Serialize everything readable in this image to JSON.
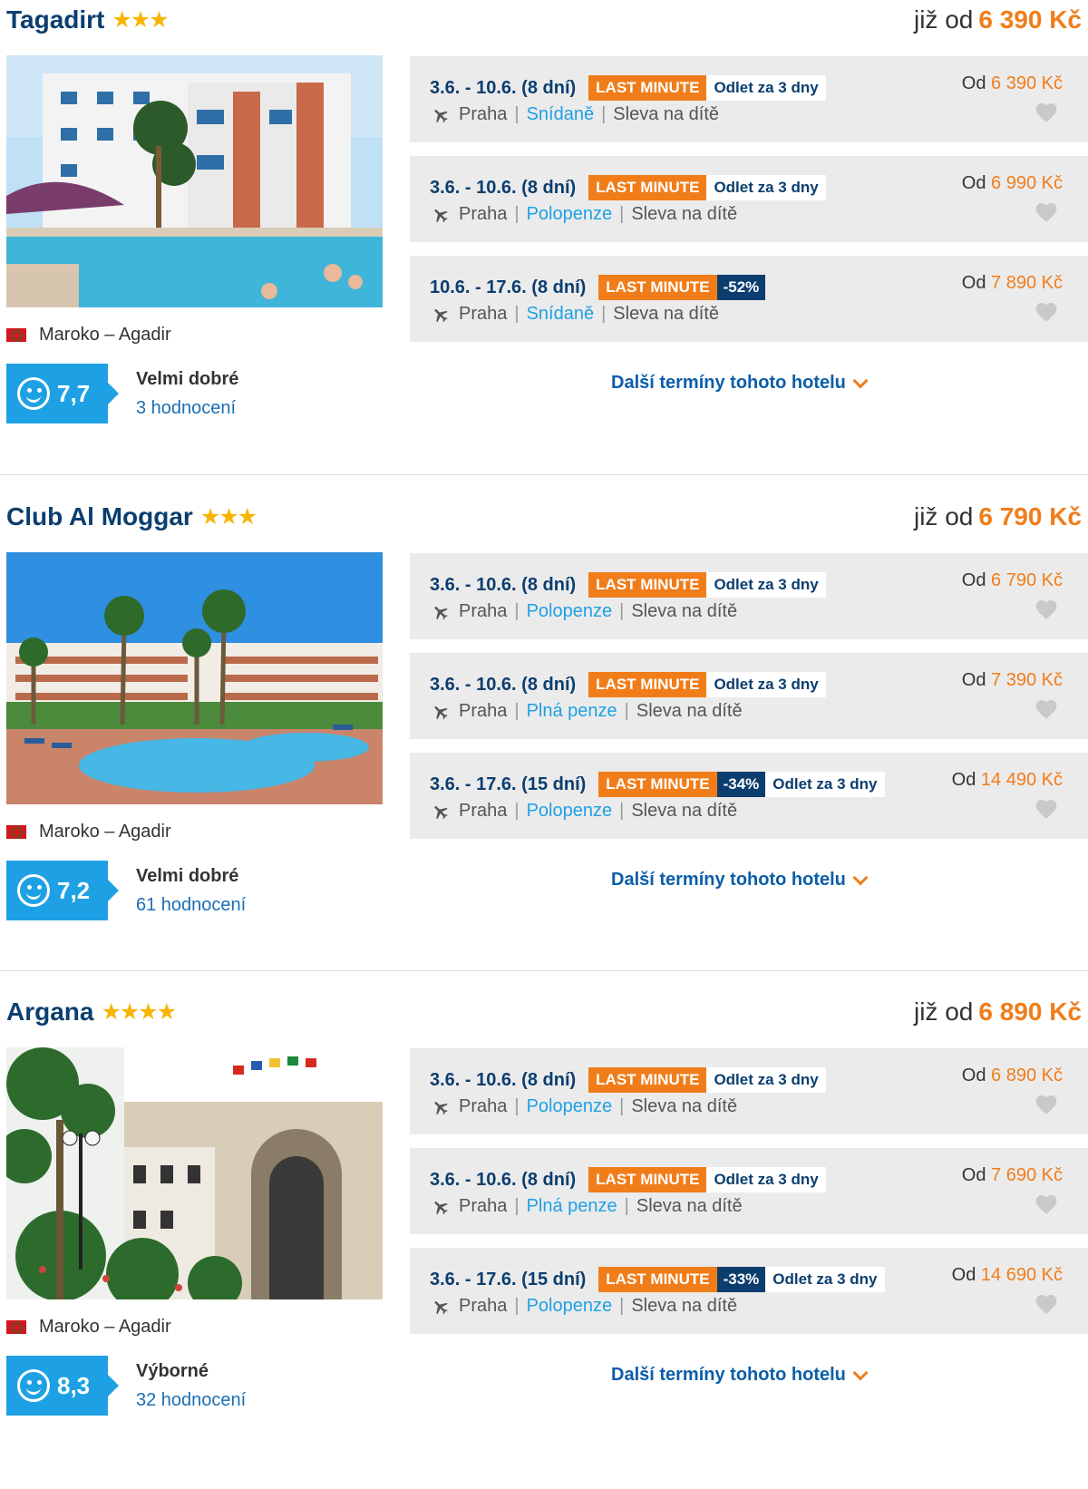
{
  "hotels": [
    {
      "name": "Tagadirt",
      "stars": "★★★",
      "price_prefix": "již od",
      "price": "6 390 Kč",
      "location": "Maroko – Agadir",
      "score": "7,7",
      "rating_label": "Velmi dobré",
      "rating_count": "3 hodnocení",
      "more_label": "Další termíny tohoto hotelu",
      "terms": [
        {
          "dates": "3.6. - 10.6. (8 dní)",
          "lm": "LAST MINUTE",
          "disc": "",
          "dep": "Odlet za 3 dny",
          "from": "Praha",
          "board": "Snídaně",
          "child": "Sleva na dítě",
          "price_prefix": "Od",
          "price": "6 390 Kč"
        },
        {
          "dates": "3.6. - 10.6. (8 dní)",
          "lm": "LAST MINUTE",
          "disc": "",
          "dep": "Odlet za 3 dny",
          "from": "Praha",
          "board": "Polopenze",
          "child": "Sleva na dítě",
          "price_prefix": "Od",
          "price": "6 990 Kč"
        },
        {
          "dates": "10.6. - 17.6. (8 dní)",
          "lm": "LAST MINUTE",
          "disc": "-52%",
          "dep": "",
          "from": "Praha",
          "board": "Snídaně",
          "child": "Sleva na dítě",
          "price_prefix": "Od",
          "price": "7 890 Kč"
        }
      ]
    },
    {
      "name": "Club Al Moggar",
      "stars": "★★★",
      "price_prefix": "již od",
      "price": "6 790 Kč",
      "location": "Maroko – Agadir",
      "score": "7,2",
      "rating_label": "Velmi dobré",
      "rating_count": "61 hodnocení",
      "more_label": "Další termíny tohoto hotelu",
      "terms": [
        {
          "dates": "3.6. - 10.6. (8 dní)",
          "lm": "LAST MINUTE",
          "disc": "",
          "dep": "Odlet za 3 dny",
          "from": "Praha",
          "board": "Polopenze",
          "child": "Sleva na dítě",
          "price_prefix": "Od",
          "price": "6 790 Kč"
        },
        {
          "dates": "3.6. - 10.6. (8 dní)",
          "lm": "LAST MINUTE",
          "disc": "",
          "dep": "Odlet za 3 dny",
          "from": "Praha",
          "board": "Plná penze",
          "child": "Sleva na dítě",
          "price_prefix": "Od",
          "price": "7 390 Kč"
        },
        {
          "dates": "3.6. - 17.6. (15 dní)",
          "lm": "LAST MINUTE",
          "disc": "-34%",
          "dep": "Odlet za 3 dny",
          "from": "Praha",
          "board": "Polopenze",
          "child": "Sleva na dítě",
          "price_prefix": "Od",
          "price": "14 490 Kč"
        }
      ]
    },
    {
      "name": "Argana",
      "stars": "★★★★",
      "price_prefix": "již od",
      "price": "6 890 Kč",
      "location": "Maroko – Agadir",
      "score": "8,3",
      "rating_label": "Výborné",
      "rating_count": "32 hodnocení",
      "more_label": "Další termíny tohoto hotelu",
      "terms": [
        {
          "dates": "3.6. - 10.6. (8 dní)",
          "lm": "LAST MINUTE",
          "disc": "",
          "dep": "Odlet za 3 dny",
          "from": "Praha",
          "board": "Polopenze",
          "child": "Sleva na dítě",
          "price_prefix": "Od",
          "price": "6 890 Kč"
        },
        {
          "dates": "3.6. - 10.6. (8 dní)",
          "lm": "LAST MINUTE",
          "disc": "",
          "dep": "Odlet za 3 dny",
          "from": "Praha",
          "board": "Plná penze",
          "child": "Sleva na dítě",
          "price_prefix": "Od",
          "price": "7 690 Kč"
        },
        {
          "dates": "3.6. - 17.6. (15 dní)",
          "lm": "LAST MINUTE",
          "disc": "-33%",
          "dep": "Odlet za 3 dny",
          "from": "Praha",
          "board": "Polopenze",
          "child": "Sleva na dítě",
          "price_prefix": "Od",
          "price": "14 690 Kč"
        }
      ]
    }
  ]
}
